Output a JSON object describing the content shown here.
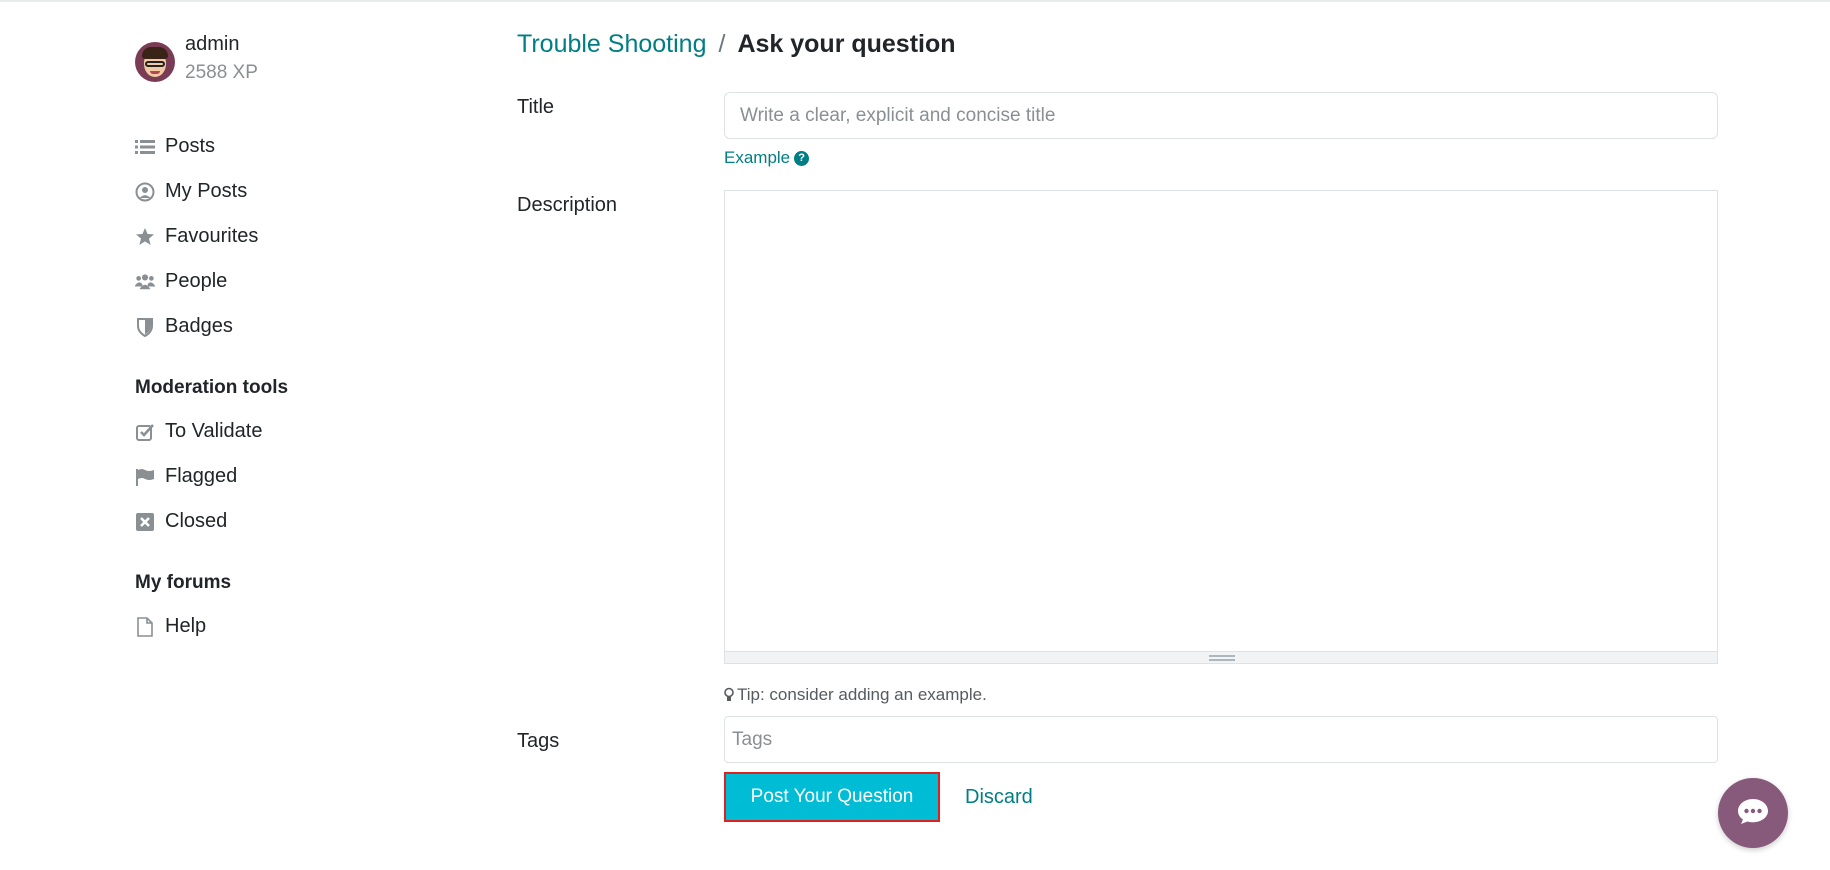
{
  "user": {
    "name": "admin",
    "xp": "2588 XP"
  },
  "sidebar": {
    "items": [
      {
        "label": "Posts",
        "icon": "list-icon"
      },
      {
        "label": "My Posts",
        "icon": "user-circle-icon"
      },
      {
        "label": "Favourites",
        "icon": "star-icon"
      },
      {
        "label": "People",
        "icon": "users-icon"
      },
      {
        "label": "Badges",
        "icon": "shield-icon"
      }
    ],
    "moderation_title": "Moderation tools",
    "moderation_items": [
      {
        "label": "To Validate",
        "icon": "check-square-icon"
      },
      {
        "label": "Flagged",
        "icon": "flag-icon"
      },
      {
        "label": "Closed",
        "icon": "close-square-icon"
      }
    ],
    "forums_title": "My forums",
    "forum_items": [
      {
        "label": "Help",
        "icon": "file-icon"
      }
    ]
  },
  "breadcrumb": {
    "parent": "Trouble Shooting",
    "separator": "/",
    "current": "Ask your question"
  },
  "form": {
    "title_label": "Title",
    "title_placeholder": "Write a clear, explicit and concise title",
    "title_value": "",
    "example_link": "Example",
    "description_label": "Description",
    "tip": "Tip: consider adding an example.",
    "tags_label": "Tags",
    "tags_placeholder": "Tags",
    "submit_label": "Post Your Question",
    "discard_label": "Discard"
  },
  "colors": {
    "link": "#017e84",
    "primary_button": "#00bcd4",
    "highlight_border": "#e0211f",
    "chat_button": "#875a7b"
  }
}
